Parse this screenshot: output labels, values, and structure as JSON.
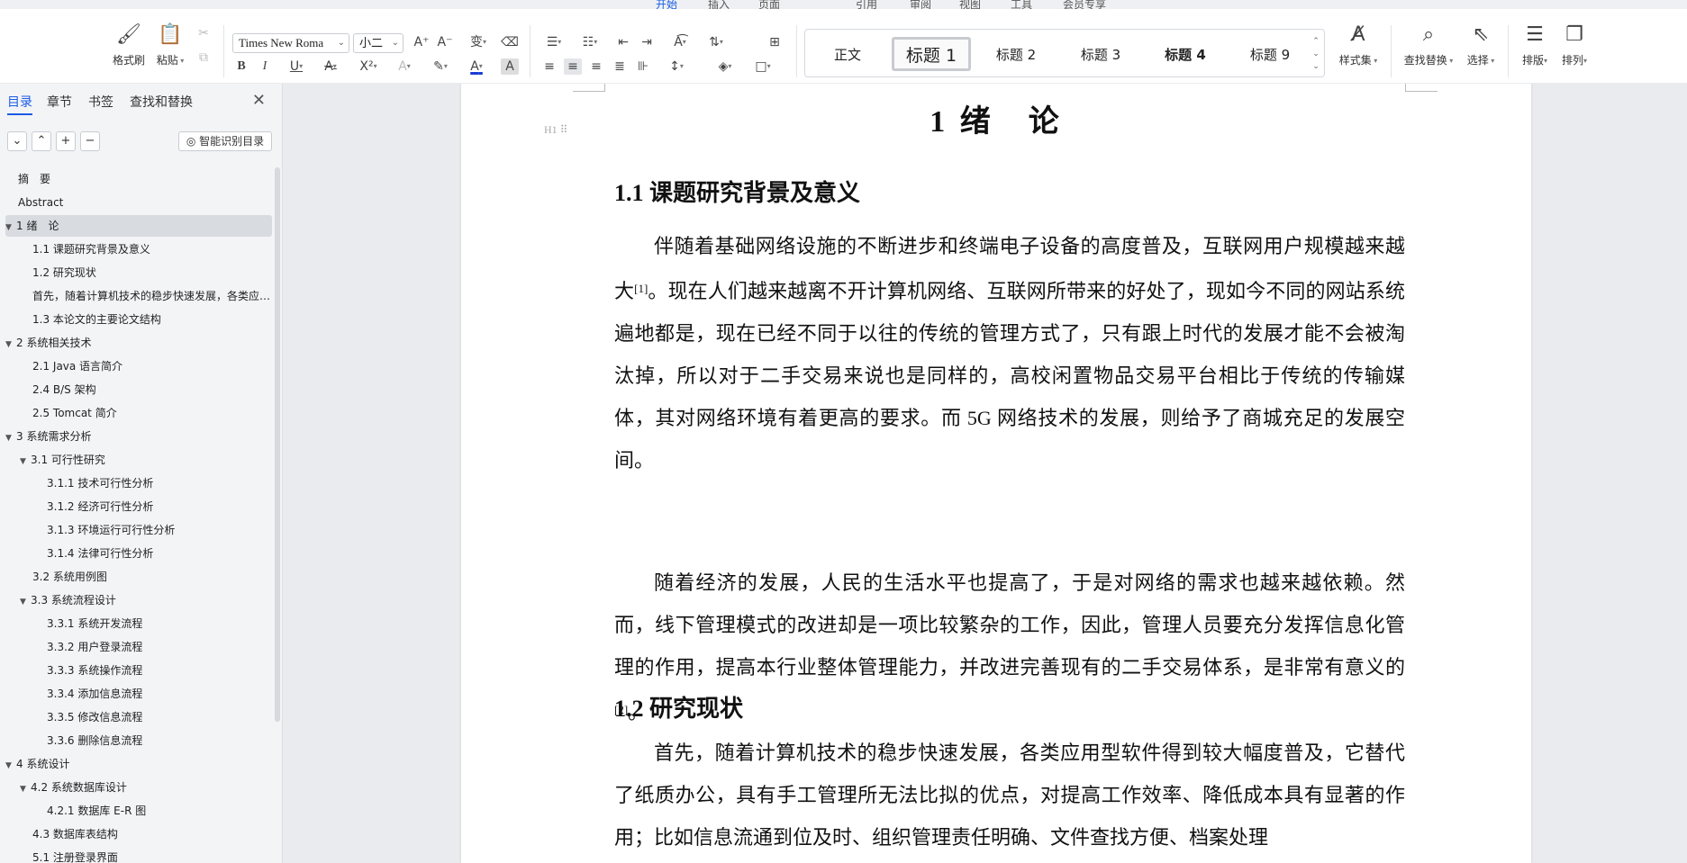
{
  "ribbon": {
    "tabs": [
      "开始",
      "插入",
      "页面",
      "引用",
      "审阅",
      "视图",
      "工具",
      "会员专享"
    ],
    "clipboard": {
      "format_painter": "格式刷",
      "paste": "粘贴"
    },
    "font": {
      "name": "Times New Roma",
      "size": "小二"
    },
    "styles": [
      {
        "label": "正文"
      },
      {
        "label": "标题 1"
      },
      {
        "label": "标题 2"
      },
      {
        "label": "标题 3"
      },
      {
        "label": "标题 4"
      },
      {
        "label": "标题 9"
      }
    ],
    "style_set": "样式集",
    "find_replace": "查找替换",
    "select": "选择",
    "layout": "排版",
    "arrange": "排列"
  },
  "nav": {
    "tabs": [
      "目录",
      "章节",
      "书签",
      "查找和替换"
    ],
    "smart_toc": "智能识别目录",
    "items": [
      {
        "label": "摘　要",
        "level": 0,
        "expanded": null
      },
      {
        "label": "Abstract",
        "level": 0,
        "expanded": null
      },
      {
        "label": "1 绪　论",
        "level": 0,
        "expanded": true,
        "selected": true
      },
      {
        "label": "1.1 课题研究背景及意义",
        "level": 1,
        "expanded": null
      },
      {
        "label": "1.2 研究现状",
        "level": 1,
        "expanded": null
      },
      {
        "label": "首先，随着计算机技术的稳步快速发展，各类应用型软件得到较大幅度普及",
        "level": 1,
        "expanded": null
      },
      {
        "label": "1.3 本论文的主要论文结构",
        "level": 1,
        "expanded": null
      },
      {
        "label": "2 系统相关技术",
        "level": 0,
        "expanded": true
      },
      {
        "label": "2.1 Java 语言简介",
        "level": 1,
        "expanded": null
      },
      {
        "label": "2.4 B/S 架构",
        "level": 1,
        "expanded": null
      },
      {
        "label": "2.5 Tomcat 简介",
        "level": 1,
        "expanded": null
      },
      {
        "label": "3 系统需求分析",
        "level": 0,
        "expanded": true
      },
      {
        "label": "3.1 可行性研究",
        "level": 1,
        "expanded": true
      },
      {
        "label": "3.1.1 技术可行性分析",
        "level": 2,
        "expanded": null
      },
      {
        "label": "3.1.2  经济可行性分析",
        "level": 2,
        "expanded": null
      },
      {
        "label": "3.1.3  环境运行可行性分析",
        "level": 2,
        "expanded": null
      },
      {
        "label": "3.1.4  法律可行性分析",
        "level": 2,
        "expanded": null
      },
      {
        "label": "3.2 系统用例图",
        "level": 1,
        "expanded": null
      },
      {
        "label": "3.3 系统流程设计",
        "level": 1,
        "expanded": true
      },
      {
        "label": "3.3.1  系统开发流程",
        "level": 2,
        "expanded": null
      },
      {
        "label": "3.3.2  用户登录流程",
        "level": 2,
        "expanded": null
      },
      {
        "label": "3.3.3  系统操作流程",
        "level": 2,
        "expanded": null
      },
      {
        "label": "3.3.4  添加信息流程",
        "level": 2,
        "expanded": null
      },
      {
        "label": "3.3.5  修改信息流程",
        "level": 2,
        "expanded": null
      },
      {
        "label": "3.3.6  删除信息流程",
        "level": 2,
        "expanded": null
      },
      {
        "label": "4 系统设计",
        "level": 0,
        "expanded": true
      },
      {
        "label": "4.2 系统数据库设计",
        "level": 1,
        "expanded": true
      },
      {
        "label": "4.2.1 数据库 E-R 图",
        "level": 2,
        "expanded": null
      },
      {
        "label": "4.3 数据库表结构",
        "level": 1,
        "expanded": null
      },
      {
        "label": "5.1 注册登录界面",
        "level": 1,
        "expanded": null
      }
    ]
  },
  "doc": {
    "h1_marker": "H1",
    "chapter_title": "1 绪　论",
    "s11_title": "1.1 课题研究背景及意义",
    "p1_a": "伴随着基础网络设施的不断进步和终端电子设备的高度普及，互联网用户规模越来越大",
    "p1_ref": "[1]",
    "p1_b": "。现在人们越来越离不开计算机网络、互联网所带来的好处了，现如今不同的网站系统遍地都是，现在已经不同于以往的传统的管理方式了，只有跟上时代的发展才能不会被淘汰掉，所以对于二手交易来说也是同样的，高校闲置物品交易平台相比于传统的传输媒体，其对网络环境有着更高的要求。而 5G 网络技术的发展，则给予了商城充足的发展空间。",
    "p2_a": "随着经济的发展，人民的生活水平也提高了，于是对网络的需求也越来越依赖。然而，线下管理模式的改进却是一项比较繁杂的工作，因此，管理人员要充分发挥信息化管理的作用，提高本行业整体管理能力，并改进完善现有的二手交易体系，是非常有意义的",
    "p2_ref": "[2]",
    "p2_b": "。",
    "s12_title": "1.2 研究现状",
    "p3": "首先，随着计算机技术的稳步快速发展，各类应用型软件得到较大幅度普及，它替代了纸质办公，具有手工管理所无法比拟的优点，对提高工作效率、降低成本具有显著的作用；比如信息流通到位及时、组织管理责任明确、文件查找方便、档案处理"
  }
}
